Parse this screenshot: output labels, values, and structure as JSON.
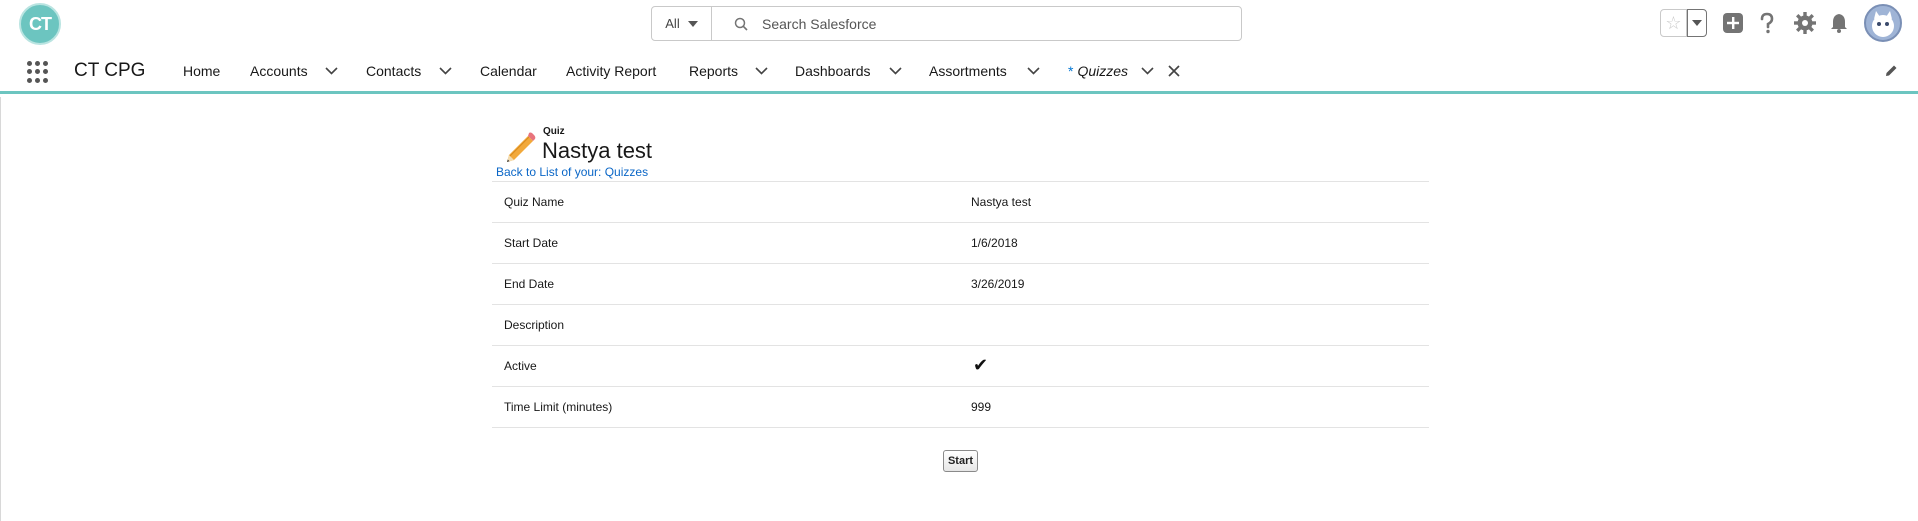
{
  "header": {
    "logo_text": "CT",
    "search": {
      "scope": "All",
      "placeholder": "Search Salesforce"
    },
    "icons": [
      "star-icon",
      "chevron-down-icon",
      "plus-icon",
      "question-icon",
      "gear-icon",
      "bell-icon",
      "avatar"
    ]
  },
  "nav": {
    "app_name": "CT CPG",
    "items": [
      {
        "label": "Home"
      },
      {
        "label": "Accounts"
      },
      {
        "label": "Contacts"
      },
      {
        "label": "Calendar"
      },
      {
        "label": "Activity Report"
      },
      {
        "label": "Reports"
      },
      {
        "label": "Dashboards"
      },
      {
        "label": "Assortments"
      },
      {
        "label": "Quizzes"
      }
    ],
    "active_marker": "*"
  },
  "page": {
    "object_label": "Quiz",
    "title": "Nastya test",
    "back_link": "Back to List of your: Quizzes",
    "fields": [
      {
        "label": "Quiz Name",
        "value": "Nastya test"
      },
      {
        "label": "Start Date",
        "value": "1/6/2018"
      },
      {
        "label": "End Date",
        "value": "3/26/2019"
      },
      {
        "label": "Description",
        "value": ""
      },
      {
        "label": "Active",
        "value": "✔"
      },
      {
        "label": "Time Limit (minutes)",
        "value": "999"
      }
    ],
    "start_button": "Start"
  },
  "colors": {
    "brand": "#6cc5c0",
    "link": "#0b67c7"
  }
}
